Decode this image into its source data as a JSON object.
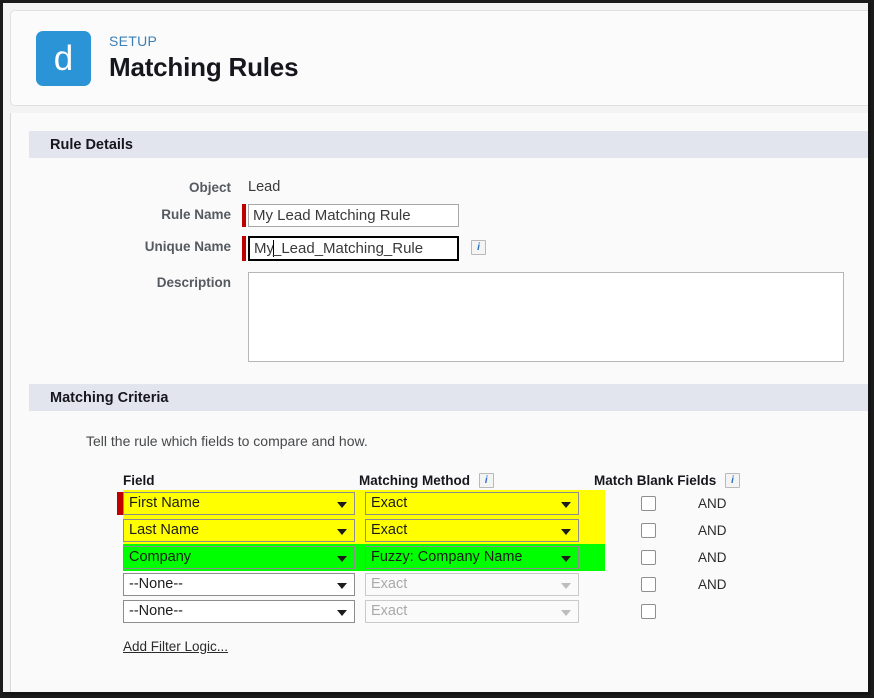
{
  "header": {
    "app_tile_letter": "d",
    "eyebrow": "SETUP",
    "title": "Matching Rules"
  },
  "rule_details": {
    "section_title": "Rule Details",
    "object_label": "Object",
    "object_value": "Lead",
    "rule_name_label": "Rule Name",
    "rule_name_value": "My Lead Matching Rule",
    "unique_name_label": "Unique Name",
    "unique_name_before_caret": "My",
    "unique_name_after_caret": "_Lead_Matching_Rule",
    "unique_name_info_icon": "info-icon",
    "description_label": "Description",
    "description_value": ""
  },
  "matching_criteria": {
    "section_title": "Matching Criteria",
    "helper_text": "Tell the rule which fields to compare and how.",
    "headers": {
      "field": "Field",
      "matching_method": "Matching Method",
      "match_blank_fields": "Match Blank Fields",
      "method_info_icon": "info-icon",
      "blank_info_icon": "info-icon"
    },
    "rows": [
      {
        "field": "First Name",
        "method": "Exact",
        "highlight": "yellow",
        "required": true,
        "method_disabled": false,
        "blank_checked": false,
        "connector": "AND"
      },
      {
        "field": "Last Name",
        "method": "Exact",
        "highlight": "yellow",
        "required": false,
        "method_disabled": false,
        "blank_checked": false,
        "connector": "AND"
      },
      {
        "field": "Company",
        "method": "Fuzzy: Company Name",
        "highlight": "green",
        "required": false,
        "method_disabled": false,
        "blank_checked": false,
        "connector": "AND"
      },
      {
        "field": "--None--",
        "method": "Exact",
        "highlight": "none",
        "required": false,
        "method_disabled": true,
        "blank_checked": false,
        "connector": "AND"
      },
      {
        "field": "--None--",
        "method": "Exact",
        "highlight": "none",
        "required": false,
        "method_disabled": true,
        "blank_checked": false,
        "connector": ""
      }
    ],
    "add_filter_logic": "Add Filter Logic..."
  },
  "colors": {
    "brand_blue": "#2a94d6",
    "eyebrow_blue": "#3b7fb5",
    "section_bar": "#e3e5ee",
    "required_red": "#c00000",
    "highlight_yellow": "#ffff00",
    "highlight_green": "#00ff00"
  }
}
